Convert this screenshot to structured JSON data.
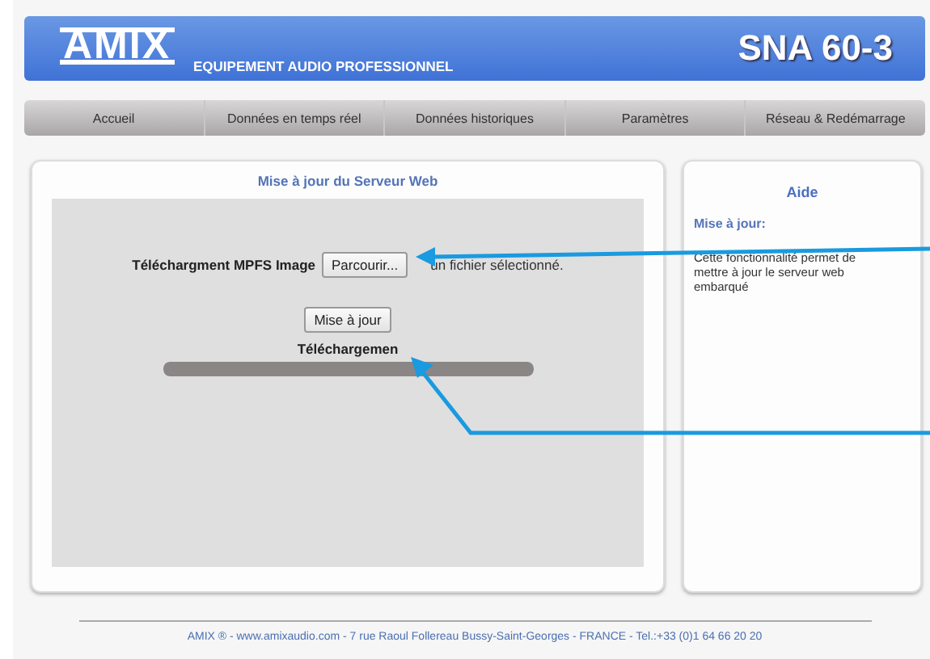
{
  "header": {
    "logo": "AMIX",
    "tagline": "EQUIPEMENT AUDIO PROFESSIONNEL",
    "model": "SNA 60-3"
  },
  "nav": [
    {
      "label": "Accueil"
    },
    {
      "label": "Données en temps réel"
    },
    {
      "label": "Données historiques"
    },
    {
      "label": "Paramètres"
    },
    {
      "label": "Réseau & Redémarrage"
    }
  ],
  "main": {
    "title": "Mise à jour du Serveur Web",
    "upload_label": "Téléchargment MPFS Image",
    "browse_button": "Parcourir...",
    "file_status": "un fichier sélectionné.",
    "update_button": "Mise à jour",
    "progress_label": "Téléchargemen",
    "progress": {
      "level": 1
    }
  },
  "help": {
    "title": "Aide",
    "subtitle": "Mise à jour:",
    "text": "Cette fonctionnalité permet de mettre à jour le serveur web embarqué"
  },
  "footer": "AMIX ® - www.amixaudio.com - 7 rue Raoul Follereau Bussy-Saint-Georges - FRANCE - Tel.:+33 (0)1 64 66 20 20"
}
